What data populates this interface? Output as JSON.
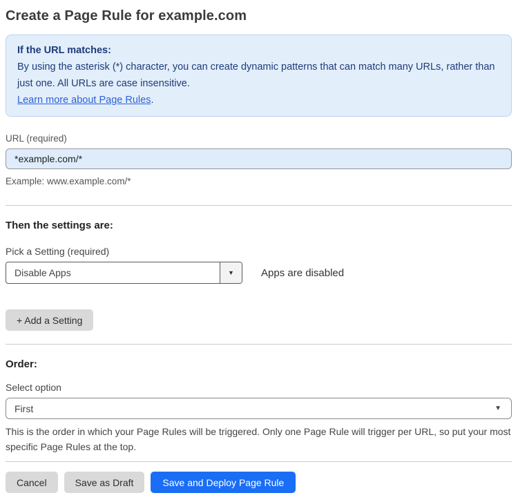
{
  "page": {
    "title": "Create a Page Rule for example.com"
  },
  "info_box": {
    "heading": "If the URL matches:",
    "body": "By using the asterisk (*) character, you can create dynamic patterns that can match many URLs, rather than just one. All URLs are case insensitive.",
    "link_label": "Learn more about Page Rules",
    "link_suffix": "."
  },
  "url_field": {
    "label": "URL (required)",
    "value": "*example.com/*",
    "helper": "Example: www.example.com/*"
  },
  "settings_section": {
    "heading": "Then the settings are:",
    "picker_label": "Pick a Setting (required)",
    "selected_setting": "Disable Apps",
    "dropdown_caret": "▼",
    "status_text": "Apps are disabled",
    "add_setting_label": "+ Add a Setting"
  },
  "order_section": {
    "heading": "Order:",
    "select_label": "Select option",
    "selected_option": "First",
    "select_caret": "▼",
    "helper": "This is the order in which your Page Rules will be triggered. Only one Page Rule will trigger per URL, so put your most specific Page Rules at the top."
  },
  "footer": {
    "cancel_label": "Cancel",
    "save_draft_label": "Save as Draft",
    "save_deploy_label": "Save and Deploy Page Rule"
  },
  "colors": {
    "info_box_bg": "#e3eefb",
    "info_box_border": "#b9d3f1",
    "info_box_text": "#1d3c78",
    "link_blue": "#2b62d9",
    "url_input_bg": "#dfecfc",
    "primary_button_blue": "#1a6ef5",
    "gray_button_bg": "#d9d9d9"
  }
}
